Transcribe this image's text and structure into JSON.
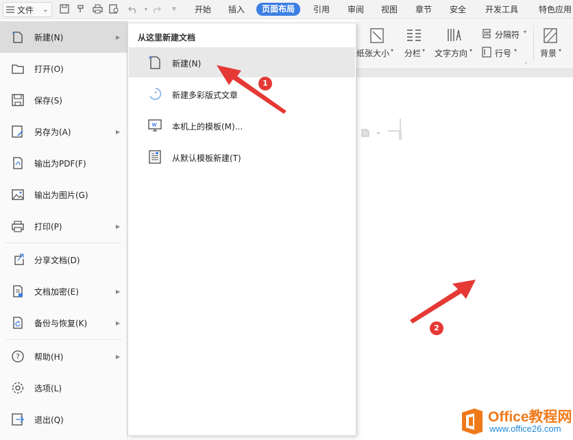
{
  "file_menu": {
    "label": "文件"
  },
  "menu_tabs": [
    {
      "label": "开始",
      "active": false
    },
    {
      "label": "插入",
      "active": false
    },
    {
      "label": "页面布局",
      "active": true
    },
    {
      "label": "引用",
      "active": false
    },
    {
      "label": "审阅",
      "active": false
    },
    {
      "label": "视图",
      "active": false
    },
    {
      "label": "章节",
      "active": false
    },
    {
      "label": "安全",
      "active": false
    },
    {
      "label": "开发工具",
      "active": false
    },
    {
      "label": "特色应用",
      "active": false
    }
  ],
  "ribbon": {
    "paper_size": "纸张大小",
    "columns": "分栏",
    "text_direction": "文字方向",
    "separator": "分隔符",
    "line_number": "行号",
    "background": "背景"
  },
  "left_menu": {
    "items": [
      {
        "label": "新建(N)",
        "icon": "new-doc-icon",
        "submenu": true
      },
      {
        "label": "打开(O)",
        "icon": "folder-open-icon",
        "submenu": false
      },
      {
        "label": "保存(S)",
        "icon": "save-icon",
        "submenu": false
      },
      {
        "label": "另存为(A)",
        "icon": "save-as-icon",
        "submenu": true
      },
      {
        "label": "输出为PDF(F)",
        "icon": "pdf-export-icon",
        "submenu": false
      },
      {
        "label": "输出为图片(G)",
        "icon": "image-export-icon",
        "submenu": false
      },
      {
        "label": "打印(P)",
        "icon": "print-icon",
        "submenu": true
      },
      {
        "label": "分享文档(D)",
        "icon": "share-icon",
        "submenu": false
      },
      {
        "label": "文档加密(E)",
        "icon": "lock-doc-icon",
        "submenu": true
      },
      {
        "label": "备份与恢复(K)",
        "icon": "backup-icon",
        "submenu": true
      },
      {
        "label": "帮助(H)",
        "icon": "help-icon",
        "submenu": true
      },
      {
        "label": "选项(L)",
        "icon": "gear-icon",
        "submenu": false
      },
      {
        "label": "退出(Q)",
        "icon": "exit-icon",
        "submenu": false
      }
    ]
  },
  "submenu": {
    "title": "从这里新建文档",
    "items": [
      {
        "label": "新建(N)",
        "icon": "new-doc-icon"
      },
      {
        "label": "新建多彩版式文章",
        "icon": "colorful-article-icon"
      },
      {
        "label": "本机上的模板(M)...",
        "icon": "local-template-icon"
      },
      {
        "label": "从默认模板新建(T)",
        "icon": "default-template-icon"
      }
    ]
  },
  "annotations": {
    "badge1": "1",
    "badge2": "2",
    "color": "#e53935"
  },
  "watermark": {
    "title": "Office教程网",
    "url": "www.office26.com"
  },
  "colors": {
    "accent": "#3c7fe4",
    "menu_bg": "#fafafa",
    "selected": "#dcdcdc"
  }
}
